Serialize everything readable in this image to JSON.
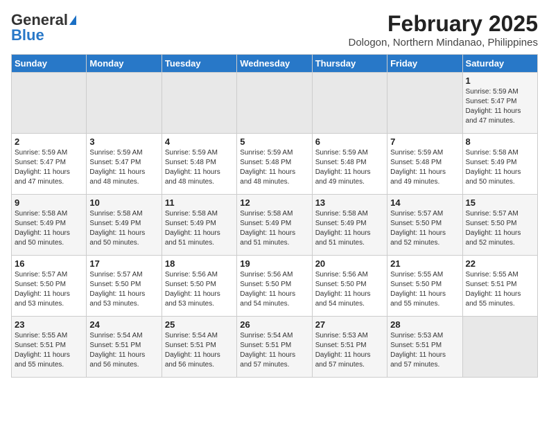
{
  "header": {
    "logo_general": "General",
    "logo_blue": "Blue",
    "title": "February 2025",
    "subtitle": "Dologon, Northern Mindanao, Philippines"
  },
  "days_of_week": [
    "Sunday",
    "Monday",
    "Tuesday",
    "Wednesday",
    "Thursday",
    "Friday",
    "Saturday"
  ],
  "weeks": [
    [
      {
        "day": "",
        "info": ""
      },
      {
        "day": "",
        "info": ""
      },
      {
        "day": "",
        "info": ""
      },
      {
        "day": "",
        "info": ""
      },
      {
        "day": "",
        "info": ""
      },
      {
        "day": "",
        "info": ""
      },
      {
        "day": "1",
        "info": "Sunrise: 5:59 AM\nSunset: 5:47 PM\nDaylight: 11 hours\nand 47 minutes."
      }
    ],
    [
      {
        "day": "2",
        "info": "Sunrise: 5:59 AM\nSunset: 5:47 PM\nDaylight: 11 hours\nand 47 minutes."
      },
      {
        "day": "3",
        "info": "Sunrise: 5:59 AM\nSunset: 5:47 PM\nDaylight: 11 hours\nand 48 minutes."
      },
      {
        "day": "4",
        "info": "Sunrise: 5:59 AM\nSunset: 5:48 PM\nDaylight: 11 hours\nand 48 minutes."
      },
      {
        "day": "5",
        "info": "Sunrise: 5:59 AM\nSunset: 5:48 PM\nDaylight: 11 hours\nand 48 minutes."
      },
      {
        "day": "6",
        "info": "Sunrise: 5:59 AM\nSunset: 5:48 PM\nDaylight: 11 hours\nand 49 minutes."
      },
      {
        "day": "7",
        "info": "Sunrise: 5:59 AM\nSunset: 5:48 PM\nDaylight: 11 hours\nand 49 minutes."
      },
      {
        "day": "8",
        "info": "Sunrise: 5:58 AM\nSunset: 5:49 PM\nDaylight: 11 hours\nand 50 minutes."
      }
    ],
    [
      {
        "day": "9",
        "info": "Sunrise: 5:58 AM\nSunset: 5:49 PM\nDaylight: 11 hours\nand 50 minutes."
      },
      {
        "day": "10",
        "info": "Sunrise: 5:58 AM\nSunset: 5:49 PM\nDaylight: 11 hours\nand 50 minutes."
      },
      {
        "day": "11",
        "info": "Sunrise: 5:58 AM\nSunset: 5:49 PM\nDaylight: 11 hours\nand 51 minutes."
      },
      {
        "day": "12",
        "info": "Sunrise: 5:58 AM\nSunset: 5:49 PM\nDaylight: 11 hours\nand 51 minutes."
      },
      {
        "day": "13",
        "info": "Sunrise: 5:58 AM\nSunset: 5:49 PM\nDaylight: 11 hours\nand 51 minutes."
      },
      {
        "day": "14",
        "info": "Sunrise: 5:57 AM\nSunset: 5:50 PM\nDaylight: 11 hours\nand 52 minutes."
      },
      {
        "day": "15",
        "info": "Sunrise: 5:57 AM\nSunset: 5:50 PM\nDaylight: 11 hours\nand 52 minutes."
      }
    ],
    [
      {
        "day": "16",
        "info": "Sunrise: 5:57 AM\nSunset: 5:50 PM\nDaylight: 11 hours\nand 53 minutes."
      },
      {
        "day": "17",
        "info": "Sunrise: 5:57 AM\nSunset: 5:50 PM\nDaylight: 11 hours\nand 53 minutes."
      },
      {
        "day": "18",
        "info": "Sunrise: 5:56 AM\nSunset: 5:50 PM\nDaylight: 11 hours\nand 53 minutes."
      },
      {
        "day": "19",
        "info": "Sunrise: 5:56 AM\nSunset: 5:50 PM\nDaylight: 11 hours\nand 54 minutes."
      },
      {
        "day": "20",
        "info": "Sunrise: 5:56 AM\nSunset: 5:50 PM\nDaylight: 11 hours\nand 54 minutes."
      },
      {
        "day": "21",
        "info": "Sunrise: 5:55 AM\nSunset: 5:50 PM\nDaylight: 11 hours\nand 55 minutes."
      },
      {
        "day": "22",
        "info": "Sunrise: 5:55 AM\nSunset: 5:51 PM\nDaylight: 11 hours\nand 55 minutes."
      }
    ],
    [
      {
        "day": "23",
        "info": "Sunrise: 5:55 AM\nSunset: 5:51 PM\nDaylight: 11 hours\nand 55 minutes."
      },
      {
        "day": "24",
        "info": "Sunrise: 5:54 AM\nSunset: 5:51 PM\nDaylight: 11 hours\nand 56 minutes."
      },
      {
        "day": "25",
        "info": "Sunrise: 5:54 AM\nSunset: 5:51 PM\nDaylight: 11 hours\nand 56 minutes."
      },
      {
        "day": "26",
        "info": "Sunrise: 5:54 AM\nSunset: 5:51 PM\nDaylight: 11 hours\nand 57 minutes."
      },
      {
        "day": "27",
        "info": "Sunrise: 5:53 AM\nSunset: 5:51 PM\nDaylight: 11 hours\nand 57 minutes."
      },
      {
        "day": "28",
        "info": "Sunrise: 5:53 AM\nSunset: 5:51 PM\nDaylight: 11 hours\nand 57 minutes."
      },
      {
        "day": "",
        "info": ""
      }
    ]
  ]
}
